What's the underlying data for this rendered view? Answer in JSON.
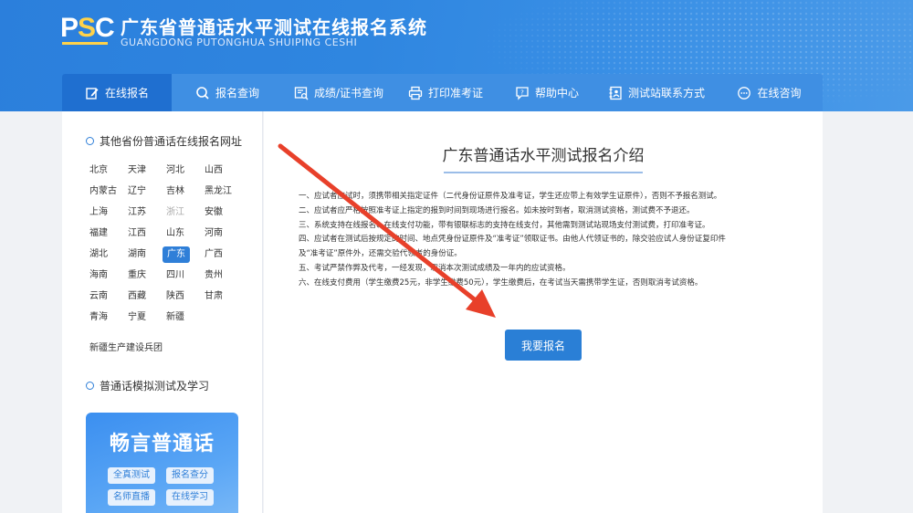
{
  "header": {
    "logo_text_p": "P",
    "logo_text_s": "S",
    "logo_text_c": "C",
    "title": "广东省普通话水平测试在线报名系统",
    "subtitle": "GUANGDONG PUTONGHUA SHUIPING CESHI"
  },
  "nav": {
    "items": [
      {
        "label": "在线报名",
        "icon": "edit-icon"
      },
      {
        "label": "报名查询",
        "icon": "search-icon"
      },
      {
        "label": "成绩/证书查询",
        "icon": "certificate-search-icon"
      },
      {
        "label": "打印准考证",
        "icon": "printer-icon"
      },
      {
        "label": "帮助中心",
        "icon": "help-icon"
      },
      {
        "label": "测试站联系方式",
        "icon": "contact-book-icon"
      },
      {
        "label": "在线咨询",
        "icon": "chat-icon"
      }
    ],
    "active_index": 0
  },
  "sidebar": {
    "provinces_heading": "其他省份普通话在线报名网址",
    "provinces": [
      {
        "name": "北京"
      },
      {
        "name": "天津"
      },
      {
        "name": "河北"
      },
      {
        "name": "山西"
      },
      {
        "name": "内蒙古"
      },
      {
        "name": "辽宁"
      },
      {
        "name": "吉林"
      },
      {
        "name": "黑龙江"
      },
      {
        "name": "上海"
      },
      {
        "name": "江苏"
      },
      {
        "name": "浙江",
        "state": "disabled"
      },
      {
        "name": "安徽"
      },
      {
        "name": "福建"
      },
      {
        "name": "江西"
      },
      {
        "name": "山东"
      },
      {
        "name": "河南"
      },
      {
        "name": "湖北"
      },
      {
        "name": "湖南"
      },
      {
        "name": "广东",
        "state": "active"
      },
      {
        "name": "广西"
      },
      {
        "name": "海南"
      },
      {
        "name": "重庆"
      },
      {
        "name": "四川"
      },
      {
        "name": "贵州"
      },
      {
        "name": "云南"
      },
      {
        "name": "西藏"
      },
      {
        "name": "陕西"
      },
      {
        "name": "甘肃"
      },
      {
        "name": "青海"
      },
      {
        "name": "宁夏"
      },
      {
        "name": "新疆"
      }
    ],
    "special_province": "新疆生产建设兵团",
    "practice_heading": "普通话模拟测试及学习",
    "promo": {
      "title": "畅言普通话",
      "tags": [
        "全真测试",
        "报名查分",
        "名师直播",
        "在线学习"
      ]
    }
  },
  "main": {
    "title": "广东普通话水平测试报名介绍",
    "rules": [
      "一、应试者应试时，须携带相关指定证件（二代身份证原件及准考证，学生还应带上有效学生证原件），否则不予报名测试。",
      "二、应试者应严格按照准考证上指定的报到时间到现场进行报名。如未按时到者，取消测试资格，测试费不予退还。",
      "三、系统支持在线报名、在线支付功能，带有银联标志的支持在线支付，其他需到测试站现场支付测试费，打印准考证。",
      "四、应试者在测试后按规定的时间、地点凭身份证原件及“准考证”领取证书。由他人代领证书的，除交验应试人身份证复印件",
      "及“准考证”原件外，还需交验代领者的身份证。",
      "五、考试严禁作弊及代考，一经发现，取消本次测试成绩及一年内的应试资格。",
      "六、在线支付费用（学生缴费25元，非学生缴费50元），学生缴费后，在考试当天需携带学生证，否则取消考试资格。"
    ],
    "signup_button": "我要报名"
  },
  "colors": {
    "header_blue": "#2f86e0",
    "nav_active": "#1f6fd0",
    "accent": "#2a7fd6",
    "annotation_arrow": "#e8402a"
  }
}
